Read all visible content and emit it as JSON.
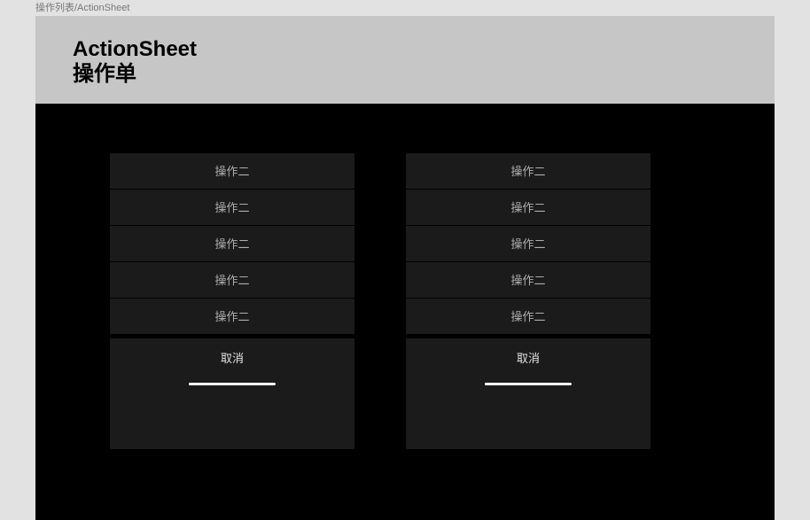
{
  "breadcrumb": "操作列表/ActionSheet",
  "header": {
    "title": "ActionSheet",
    "subtitle": "操作单"
  },
  "sheets": [
    {
      "items": [
        "操作二",
        "操作二",
        "操作二",
        "操作二",
        "操作二"
      ],
      "cancel": "取消"
    },
    {
      "items": [
        "操作二",
        "操作二",
        "操作二",
        "操作二",
        "操作二"
      ],
      "cancel": "取消"
    }
  ]
}
